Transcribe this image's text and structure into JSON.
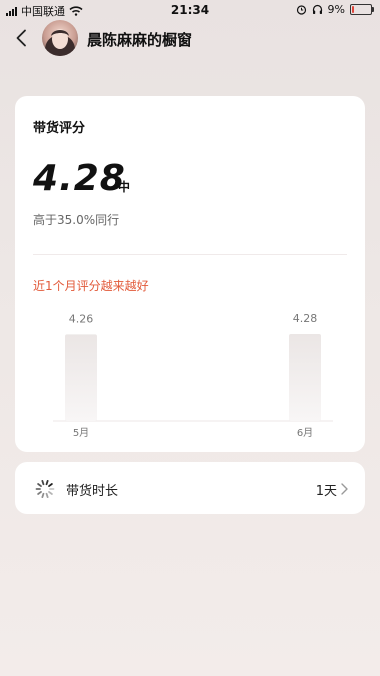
{
  "status_bar": {
    "carrier": "中国联通",
    "time": "21:34",
    "battery": "9%",
    "battery_level": 0.09
  },
  "header": {
    "shop_name": "晨陈麻麻的橱窗"
  },
  "score_card": {
    "title": "带货评分",
    "score": "4.28",
    "grade": "中",
    "compare_text": "高于35.0%同行",
    "trend_text": "近1个月评分越来越好",
    "chart_data": {
      "type": "bar",
      "categories": [
        "5月",
        "6月"
      ],
      "values": [
        4.26,
        4.28
      ],
      "data_labels": [
        "4.26",
        "4.28"
      ],
      "title": "",
      "xlabel": "",
      "ylabel": "",
      "grid": false
    }
  },
  "duration_row": {
    "label": "带货时长",
    "value": "1天"
  },
  "colors": {
    "accent": "#e25a3a",
    "bar_top": "#ebe6e5",
    "bar_bottom": "#f8f6f6"
  }
}
